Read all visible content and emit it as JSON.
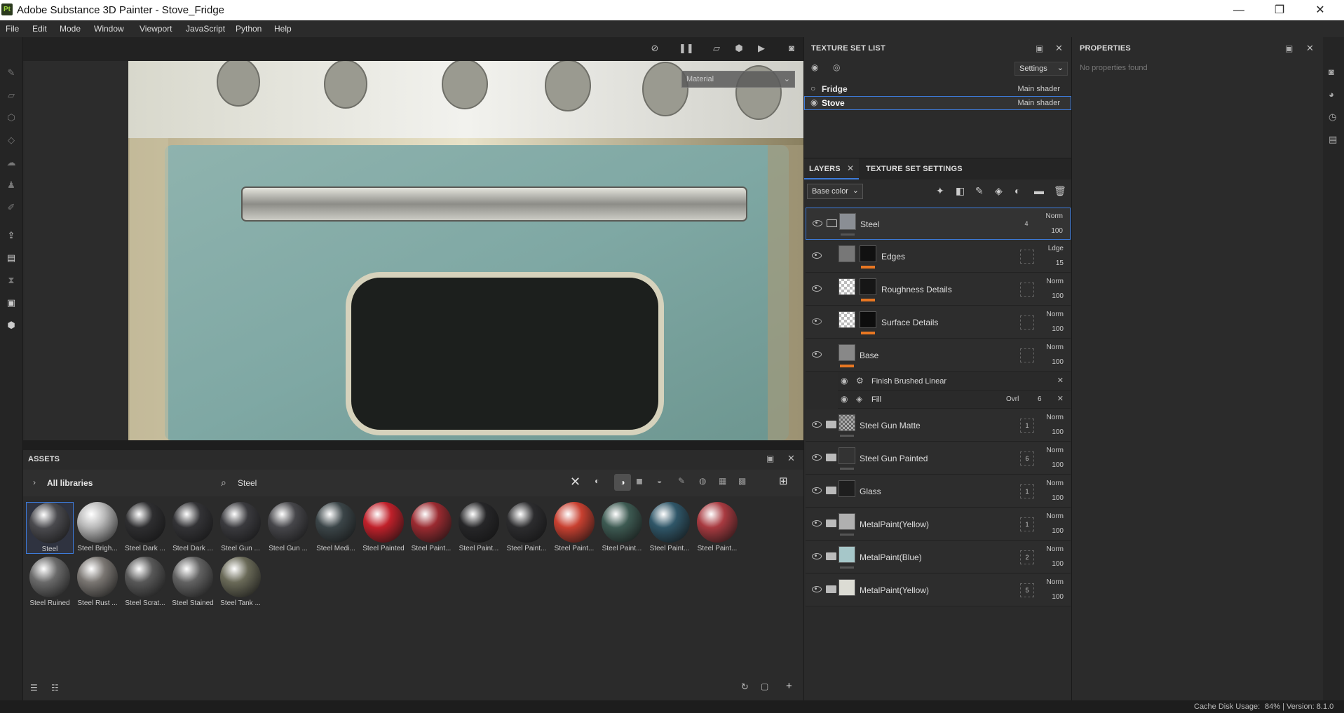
{
  "window": {
    "logo": "Pt",
    "title": "Adobe Substance 3D Painter - Stove_Fridge",
    "minimize": "—",
    "restore": "❐",
    "close": "✕"
  },
  "menu": [
    "File",
    "Edit",
    "Mode",
    "Window",
    "Viewport",
    "JavaScript",
    "Python",
    "Help"
  ],
  "viewport": {
    "channel_dropdown": "Material"
  },
  "texture_set_list": {
    "title": "TEXTURE SET LIST",
    "settings_label": "Settings",
    "sets": [
      {
        "name": "Fridge",
        "shader": "Main shader"
      },
      {
        "name": "Stove",
        "shader": "Main shader"
      }
    ]
  },
  "layers_panel": {
    "tab_layers": "LAYERS",
    "tab_texture_set_settings": "TEXTURE SET SETTINGS",
    "channel": "Base color",
    "layers": [
      {
        "name": "Steel",
        "blend": "Norm",
        "opacity": "100",
        "count": "4"
      },
      {
        "name": "Edges",
        "blend": "Ldge",
        "opacity": "15"
      },
      {
        "name": "Roughness Details",
        "blend": "Norm",
        "opacity": "100"
      },
      {
        "name": "Surface Details",
        "blend": "Norm",
        "opacity": "100"
      },
      {
        "name": "Base",
        "blend": "Norm",
        "opacity": "100"
      }
    ],
    "effects": [
      {
        "name": "Finish Brushed Linear"
      },
      {
        "name": "Fill",
        "blend": "Ovrl",
        "value": "6"
      }
    ],
    "groups": [
      {
        "name": "Steel Gun Matte",
        "blend": "Norm",
        "opacity": "100",
        "count": "1"
      },
      {
        "name": "Steel Gun Painted",
        "blend": "Norm",
        "opacity": "100",
        "count": "6"
      },
      {
        "name": "Glass",
        "blend": "Norm",
        "opacity": "100",
        "count": "1"
      },
      {
        "name": "MetalPaint(Yellow)",
        "blend": "Norm",
        "opacity": "100",
        "count": "1"
      },
      {
        "name": "MetalPaint(Blue)",
        "blend": "Norm",
        "opacity": "100",
        "count": "2"
      },
      {
        "name": "MetalPaint(Yellow)",
        "blend": "Norm",
        "opacity": "100",
        "count": "5"
      }
    ]
  },
  "properties": {
    "title": "PROPERTIES",
    "empty": "No properties found"
  },
  "assets": {
    "title": "ASSETS",
    "library": "All libraries",
    "search_value": "Steel",
    "items": [
      {
        "label": "Steel",
        "color": "#4a4a4e"
      },
      {
        "label": "Steel Brigh...",
        "color": "#b8b8b8"
      },
      {
        "label": "Steel Dark ...",
        "color": "#2e2e30"
      },
      {
        "label": "Steel Dark ...",
        "color": "#333336"
      },
      {
        "label": "Steel Gun ...",
        "color": "#3a3a3e"
      },
      {
        "label": "Steel Gun ...",
        "color": "#46464a"
      },
      {
        "label": "Steel Medi...",
        "color": "#3b4548"
      },
      {
        "label": "Steel Painted",
        "color": "#c0202a"
      },
      {
        "label": "Steel Paint...",
        "color": "#9a2a30"
      },
      {
        "label": "Steel Paint...",
        "color": "#262628"
      },
      {
        "label": "Steel Paint...",
        "color": "#2c2c2e"
      },
      {
        "label": "Steel Paint...",
        "color": "#c84030"
      },
      {
        "label": "Steel Paint...",
        "color": "#3d5a52"
      },
      {
        "label": "Steel Paint...",
        "color": "#2f5668"
      },
      {
        "label": "Steel Paint...",
        "color": "#a83a40"
      },
      {
        "label": "Steel Ruined",
        "color": "#6a6a6a"
      },
      {
        "label": "Steel Rust ...",
        "color": "#7a7672"
      },
      {
        "label": "Steel Scrat...",
        "color": "#585858"
      },
      {
        "label": "Steel Stained",
        "color": "#626262"
      },
      {
        "label": "Steel Tank ...",
        "color": "#6a6a58"
      }
    ]
  },
  "status": {
    "cache": "Cache Disk Usage:",
    "usage": "84% | Version: 8.1.0"
  }
}
